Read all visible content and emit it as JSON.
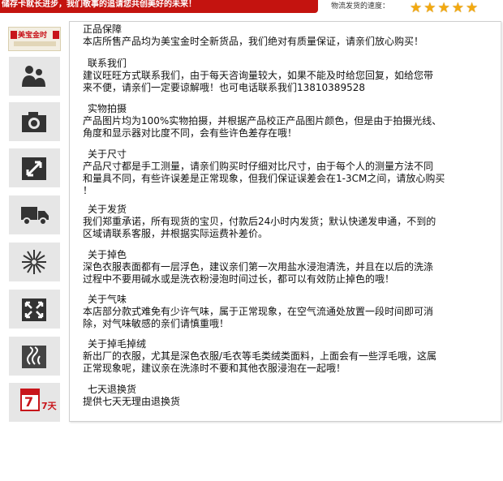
{
  "topbar": {
    "banner_text": "储存卡就长进步，我们敬事的追请您共创美好的未来！",
    "speed_label": "物流发货的速度：",
    "star_count": 5,
    "star_color": "#f3a90f",
    "banner_color": "#c4130f"
  },
  "logo": {
    "text": "美宝金时"
  },
  "sections": [
    {
      "title": "正品保障",
      "lines": [
        "本店所售产品均为美宝金时全新货品，我们绝对有质量保证，请亲们放心购买！"
      ]
    },
    {
      "title": "联系我们",
      "lines": [
        "建议旺旺方式联系我们，由于每天咨询量较大，如果不能及时给您回复，如给您带",
        "来不便，请亲们一定要谅解哦！也可电话联系我们13810389528"
      ]
    },
    {
      "title": "实物拍摄",
      "lines": [
        "产品图片均为100%实物拍摄，并根据产品校正产品图片颜色，但是由于拍摄光线、",
        "角度和显示器对比度不同，会有些许色差存在哦！"
      ]
    },
    {
      "title": "关于尺寸",
      "lines": [
        "产品尺寸都是手工测量，请亲们购买时仔细对比尺寸，由于每个人的测量方法不同",
        "和量具不同，有些许误差是正常现象，但我们保证误差会在1-3CM之间，请放心购买",
        "！"
      ]
    },
    {
      "title": "关于发货",
      "lines": [
        "我们郑重承诺，所有现货的宝贝，付款后24小时内发货；默认快递发申通，不到的",
        "区域请联系客服，并根据实际运费补差价。"
      ]
    },
    {
      "title": "关于掉色",
      "lines": [
        "深色衣服表面都有一层浮色，建议亲们第一次用盐水浸泡清洗，并且在以后的洗涤",
        "过程中不要用碱水或是洗衣粉浸泡时间过长，都可以有效防止掉色的哦！"
      ]
    },
    {
      "title": "关于气味",
      "lines": [
        "本店部分款式难免有少许气味，属于正常现象，在空气流通处放置一段时间即可消",
        "除，对气味敏感的亲们请慎重哦！"
      ]
    },
    {
      "title": "关于掉毛掉绒",
      "lines": [
        "新出厂的衣服，尤其是深色衣服/毛衣等毛类绒类面料，上面会有一些浮毛哦，这属",
        "正常现象呢，建议亲在洗涤时不要和其他衣服浸泡在一起哦！"
      ]
    },
    {
      "title": "七天退换货",
      "lines": [
        "提供七天无理由退换货"
      ]
    }
  ],
  "icons": [
    "people-icon",
    "camera-icon",
    "resize-arrow-icon",
    "truck-icon",
    "sun-burst-icon",
    "expand-arrows-icon",
    "scent-icon",
    "seven-day-calendar-icon"
  ],
  "calendar": {
    "number": "7",
    "suffix": "7天"
  }
}
